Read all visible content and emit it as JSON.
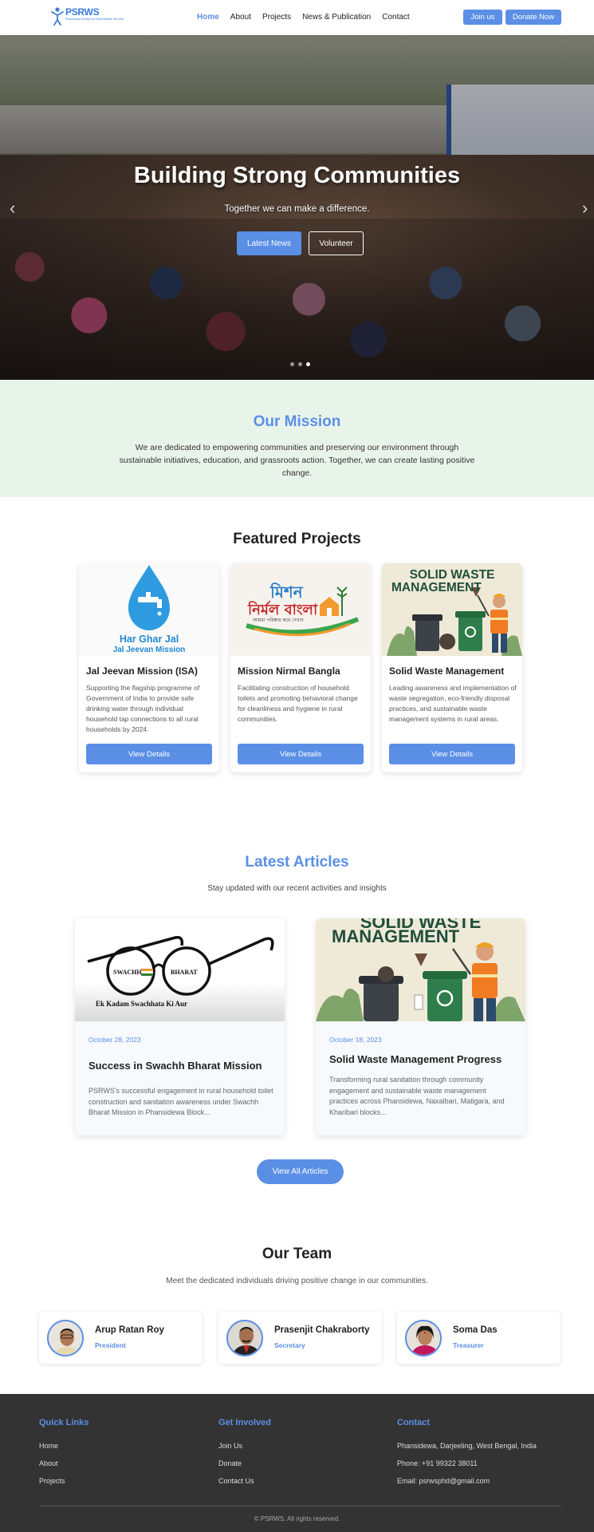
{
  "nav": {
    "logo_text": "PSRWS",
    "logo_sub": "Phansidewa Society for Rural Welfare Services",
    "links": [
      "Home",
      "About",
      "Projects",
      "News & Publication",
      "Contact"
    ],
    "join_label": "Join us",
    "donate_label": "Donate Now"
  },
  "hero": {
    "title": "Building Strong Communities",
    "subtitle": "Together we can make a difference.",
    "primary_btn": "Latest News",
    "secondary_btn": "Volunteer",
    "prev_icon": "chevron-left-icon",
    "next_icon": "chevron-right-icon",
    "active_slide": 3,
    "slides_total": 3
  },
  "mission": {
    "title": "Our Mission",
    "text": "We are dedicated to empowering communities and preserving our environment through sustainable initiatives, education, and grassroots action. Together, we can create lasting positive change."
  },
  "featured": {
    "title": "Featured Projects",
    "projects": [
      {
        "name": "Jal Jeevan Mission (ISA)",
        "desc": "Supporting the flagship programme of Government of India to provide safe drinking water through individual household tap connections to all rural households by 2024.",
        "button": "View Details",
        "img_text1": "Har Ghar Jal",
        "img_text2": "Jal Jeevan Mission"
      },
      {
        "name": "Mission Nirmal Bangla",
        "desc": "Facilitating construction of household toilets and promoting behavioral change for cleanliness and hygiene in rural communities.",
        "button": "View Details",
        "img_text1": "মিশন",
        "img_text2": "নির্মল বাংলা",
        "img_text3": "আমরা পরিষ্কার করে দেখাব"
      },
      {
        "name": "Solid Waste Management",
        "desc": "Leading awareness and implementation of waste segregation, eco-friendly disposal practices, and sustainable waste management systems in rural areas.",
        "button": "View Details",
        "img_text1": "SOLID WASTE",
        "img_text2": "MANAGEMENT"
      }
    ]
  },
  "articles": {
    "title": "Latest Articles",
    "subtitle": "Stay updated with our recent activities and insights",
    "items": [
      {
        "date": "October 28, 2023",
        "title": "Success in Swachh Bharat Mission",
        "desc": "PSRWS's successful engagement in rural household toilet construction and sanitation awareness under Swachh Bharat Mission in Phansidewa Block...",
        "img_left": "SWACHH",
        "img_right": "BHARAT",
        "img_caption": "Ek Kadam Swachhata Ki Aur"
      },
      {
        "date": "October 18, 2023",
        "title": "Solid Waste Management Progress",
        "desc": "Transforming rural sanitation through community engagement and sustainable waste management practices across Phansidewa, Naxalbari, Matigara, and Kharibari blocks...",
        "img_text1": "SOLID WASTE",
        "img_text2": "MANAGEMENT"
      }
    ],
    "all_btn": "View All Articles"
  },
  "team": {
    "title": "Our Team",
    "subtitle": "Meet the dedicated individuals driving positive change in our communities.",
    "members": [
      {
        "name": "Arup Ratan Roy",
        "role": "President"
      },
      {
        "name": "Prasenjit Chakraborty",
        "role": "Secretary"
      },
      {
        "name": "Soma Das",
        "role": "Treasurer"
      }
    ]
  },
  "footer": {
    "quick_title": "Quick Links",
    "quick_links": [
      "Home",
      "About",
      "Projects"
    ],
    "involved_title": "Get Involved",
    "involved_links": [
      "Join Us",
      "Donate",
      "Contact Us"
    ],
    "contact_title": "Contact",
    "address": "Phansidewa, Darjeeling, West Bengal, India",
    "phone": "Phone: +91 99322 38011",
    "email": "Email: psrwsphd@gmail.com",
    "copyright": "© PSRWS. All rights reserved."
  },
  "colors": {
    "accent": "#5b8fe6",
    "mission_bg": "#e8f4ea",
    "footer_bg": "#333333"
  }
}
